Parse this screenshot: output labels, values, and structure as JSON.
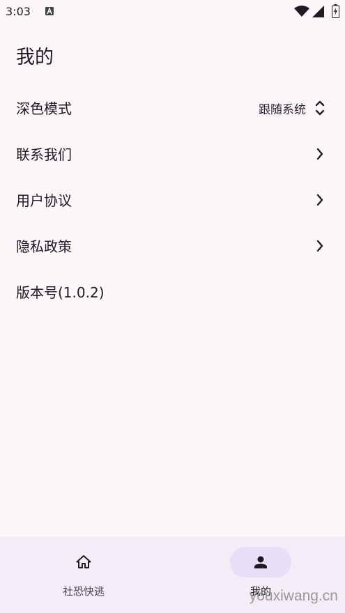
{
  "status_bar": {
    "time": "3:03",
    "icons": [
      "app-notification-icon",
      "wifi-icon",
      "signal-icon",
      "battery-icon"
    ]
  },
  "page": {
    "title": "我的"
  },
  "settings": {
    "dark_mode": {
      "label": "深色模式",
      "value": "跟随系统",
      "icon": "unfold-icon"
    },
    "contact_us": {
      "label": "联系我们",
      "icon": "chevron-right-icon"
    },
    "user_agreement": {
      "label": "用户协议",
      "icon": "chevron-right-icon"
    },
    "privacy_policy": {
      "label": "隐私政策",
      "icon": "chevron-right-icon"
    },
    "version": {
      "label": "版本号(1.0.2)"
    }
  },
  "bottom_nav": {
    "items": [
      {
        "label": "社恐快逃",
        "icon": "home-icon",
        "selected": false
      },
      {
        "label": "我的",
        "icon": "person-icon",
        "selected": true
      }
    ]
  },
  "watermark": "youxiwang.cn",
  "colors": {
    "background": "#fdf7fc",
    "nav_background": "#f3edf7",
    "nav_indicator": "#e8def8",
    "text_primary": "#1d1b20"
  }
}
